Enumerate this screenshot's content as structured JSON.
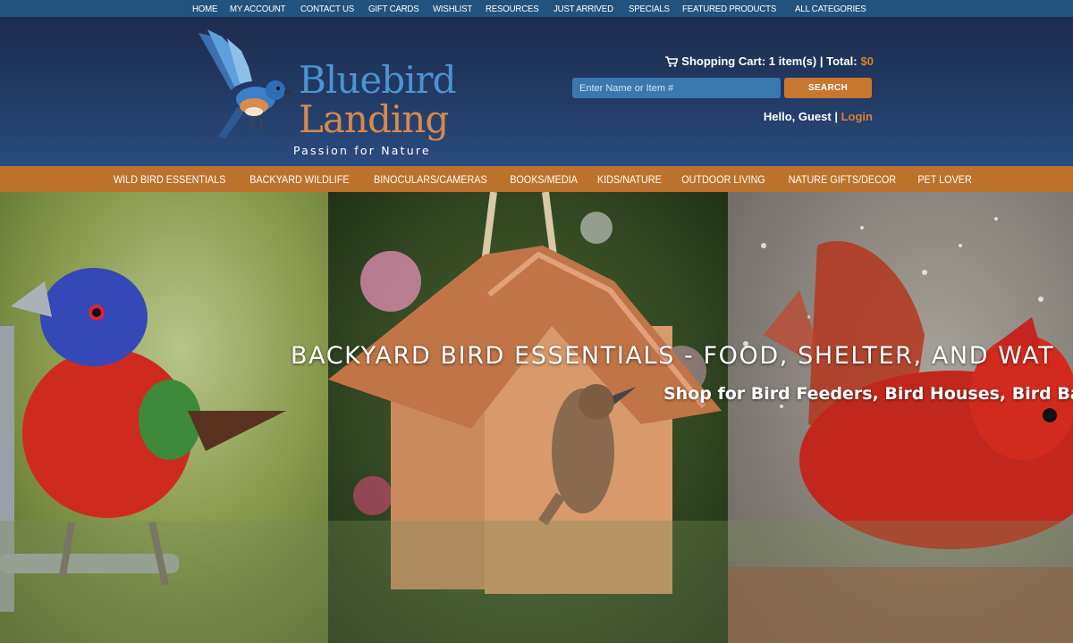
{
  "top_nav": {
    "items": [
      "HOME",
      "MY ACCOUNT",
      "CONTACT US",
      "GIFT CARDS",
      "WISHLIST",
      "RESOURCES",
      "JUST ARRIVED",
      "SPECIALS",
      "FEATURED PRODUCTS",
      "ALL CATEGORIES"
    ]
  },
  "logo": {
    "line1": "Bluebird",
    "line2": "Landing",
    "tagline": "Passion for Nature"
  },
  "cart": {
    "icon": "shopping-cart-icon",
    "label": "Shopping Cart: 1 item(s) | Total:",
    "total": "$0"
  },
  "search": {
    "placeholder": "Enter Name or Item #",
    "value": "",
    "button_label": "SEARCH"
  },
  "user": {
    "greeting": "Hello, Guest",
    "separator": "|",
    "login_label": "Login"
  },
  "category_nav": {
    "items": [
      "WILD BIRD ESSENTIALS",
      "BACKYARD WILDLIFE",
      "BINOCULARS/CAMERAS",
      "BOOKS/MEDIA",
      "KIDS/NATURE",
      "OUTDOOR LIVING",
      "NATURE GIFTS/DECOR",
      "PET LOVER"
    ]
  },
  "hero": {
    "title": "BACKYARD BIRD ESSENTIALS - FOOD, SHELTER, AND WAT",
    "subtitle": "Shop for Bird Feeders, Bird Houses, Bird Bat"
  },
  "colors": {
    "top_bar": "#22537f",
    "header": "#223b66",
    "accent_orange": "#bd722b",
    "search_field": "#3a78ad",
    "logo_blue": "#4c93d2",
    "logo_orange": "#d8894a"
  }
}
